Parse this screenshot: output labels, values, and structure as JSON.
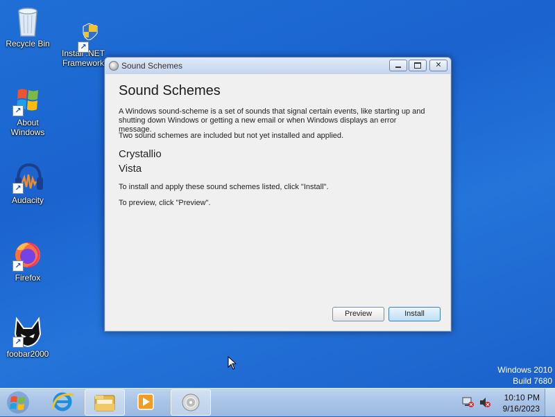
{
  "desktop": {
    "icons": [
      {
        "label": "Recycle Bin",
        "icon": "recycle-bin-icon"
      },
      {
        "label": "Install .NET Framework",
        "label_line1": "Install .NET",
        "label_line2": "Framework",
        "icon": "dotnet-installer-icon"
      },
      {
        "label": "About Windows",
        "label_line1": "About",
        "label_line2": "Windows",
        "icon": "windows-logo-icon"
      },
      {
        "label": "Audacity",
        "icon": "audacity-icon"
      },
      {
        "label": "Firefox",
        "icon": "firefox-icon"
      },
      {
        "label": "foobar2000",
        "icon": "foobar2000-icon"
      }
    ],
    "watermark": {
      "line1": "Windows 2010",
      "line2": "Build 7680"
    }
  },
  "dialog": {
    "window_title": "Sound Schemes",
    "heading": "Sound Schemes",
    "description": "A Windows sound-scheme is a set of sounds that signal certain events, like starting up and shutting down Windows or getting a new email or when Windows displays an error message.",
    "included_note": "Two sound schemes are included but not yet installed and applied.",
    "schemes": [
      "Crystallio",
      "Vista"
    ],
    "install_instruction": "To install and apply these sound schemes listed, click \"Install\".",
    "preview_instruction": "To preview, click \"Preview\".",
    "buttons": {
      "preview": "Preview",
      "install": "Install"
    }
  },
  "taskbar": {
    "pinned": [
      "internet-explorer-icon",
      "file-explorer-icon",
      "media-player-icon",
      "sound-schemes-app-icon"
    ],
    "clock": {
      "time": "10:10 PM",
      "date": "9/16/2023"
    },
    "tray_icons": [
      "network-icon",
      "volume-muted-icon"
    ]
  },
  "colors": {
    "desktop": "#1f6fd6",
    "taskbar": "#a9c4e6",
    "dialog_client": "#f0f0f0",
    "accent_button": "#bfdff5"
  }
}
